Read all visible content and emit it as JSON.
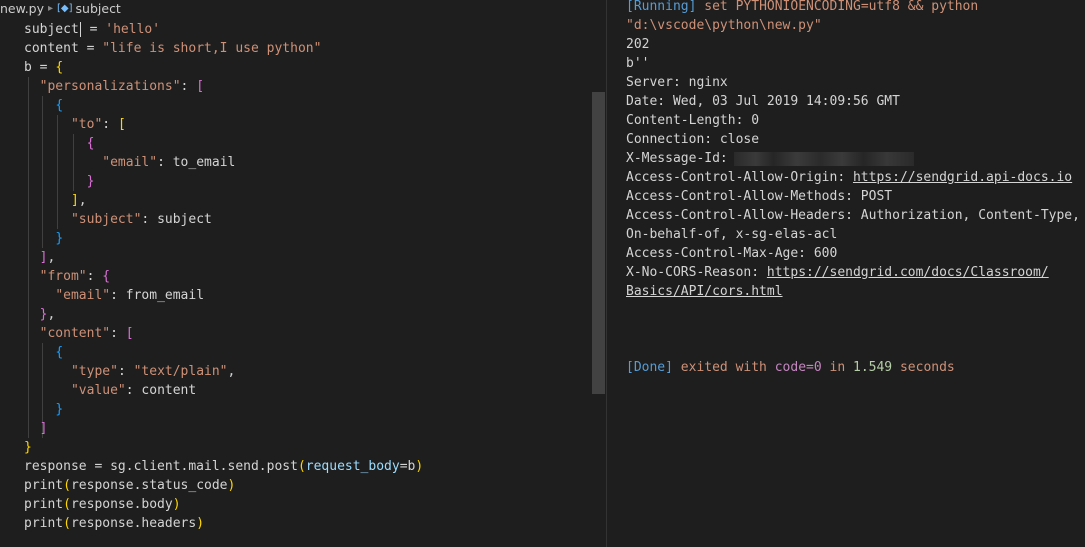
{
  "breadcrumb": {
    "file": "new.py",
    "symbol": "subject"
  },
  "code": {
    "l1a": "subject",
    "l1b": " = ",
    "l1c": "'hello'",
    "l2a": "content = ",
    "l2b": "\"life is short,I use python\"",
    "l3a": "b = ",
    "l3b": "{",
    "l4a": "\"personalizations\"",
    "l4b": ": ",
    "l4c": "[",
    "l5": "{",
    "l6a": "\"to\"",
    "l6b": ": ",
    "l6c": "[",
    "l7": "{",
    "l8a": "\"email\"",
    "l8b": ": to_email",
    "l9": "}",
    "l10a": "]",
    "l10b": ",",
    "l11a": "\"subject\"",
    "l11b": ": subject",
    "l12": "}",
    "l13a": "]",
    "l13b": ",",
    "l14a": "\"from\"",
    "l14b": ": ",
    "l14c": "{",
    "l15a": "\"email\"",
    "l15b": ": from_email",
    "l16a": "}",
    "l16b": ",",
    "l17a": "\"content\"",
    "l17b": ": ",
    "l17c": "[",
    "l18": "{",
    "l19a": "\"type\"",
    "l19b": ": ",
    "l19c": "\"text/plain\"",
    "l19d": ",",
    "l20a": "\"value\"",
    "l20b": ": content",
    "l21": "}",
    "l22": "]",
    "l23": "}",
    "l24a": "response = sg.client.mail.send.post",
    "l24b": "(",
    "l24c": "request_body",
    "l24d": "=b",
    "l24e": ")",
    "l25a": "print",
    "l25b": "(",
    "l25c": "response.status_code",
    "l25d": ")",
    "l26a": "print",
    "l26b": "(",
    "l26c": "response.body",
    "l26d": ")",
    "l27a": "print",
    "l27b": "(",
    "l27c": "response.headers",
    "l27d": ")"
  },
  "output": {
    "running_tag": "[Running]",
    "running_cmd1": " set PYTHONIOENCODING=utf8 && python",
    "running_cmd2": "\"d:\\vscode\\python\\new.py\"",
    "status": "202",
    "body": "b''",
    "server": "Server: nginx",
    "date": "Date: Wed, 03 Jul 2019 14:09:56 GMT",
    "content_length": "Content-Length: 0",
    "connection": "Connection: close",
    "message_id_label": "X-Message-Id:",
    "acao_label": "Access-Control-Allow-Origin: ",
    "acao_link": "https://sendgrid.api-docs.io",
    "acam": "Access-Control-Allow-Methods: POST",
    "acah1": "Access-Control-Allow-Headers: Authorization, Content-Type,",
    "acah2": "On-behalf-of, x-sg-elas-acl",
    "acma": "Access-Control-Max-Age: 600",
    "nocors_label": "X-No-CORS-Reason: ",
    "nocors_link1": "https://sendgrid.com/docs/Classroom/",
    "nocors_link2": "Basics/API/cors.html",
    "done_tag": "[Done]",
    "done_text1": " exited with ",
    "done_code": "code=0",
    "done_text2": " in ",
    "done_secs": "1.549",
    "done_text3": " seconds"
  }
}
